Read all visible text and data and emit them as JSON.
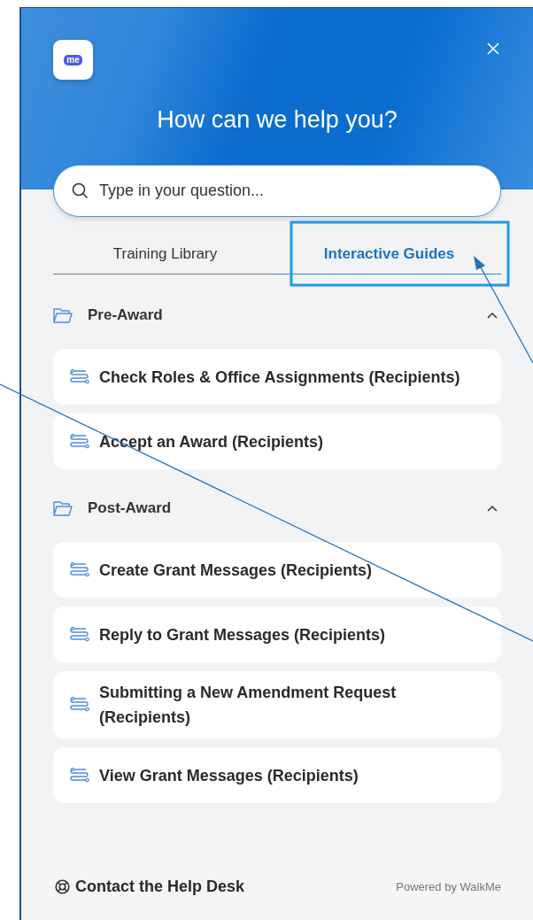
{
  "header": {
    "logo_text": "me",
    "title": "How can we help you?"
  },
  "search": {
    "placeholder": "Type in your question..."
  },
  "tabs": [
    {
      "label": "Training Library",
      "selected": false
    },
    {
      "label": "Interactive Guides",
      "selected": true
    }
  ],
  "sections": [
    {
      "title": "Pre-Award",
      "expanded": true,
      "items": [
        {
          "label": "Check Roles & Office Assignments (Recipients)"
        },
        {
          "label": "Accept an Award (Recipients)"
        }
      ]
    },
    {
      "title": "Post-Award",
      "expanded": true,
      "items": [
        {
          "label": "Create Grant Messages (Recipients)"
        },
        {
          "label": "Reply to Grant Messages (Recipients)"
        },
        {
          "label": "Submitting a New Amendment Request (Recipients)"
        },
        {
          "label": "View Grant Messages (Recipients)"
        }
      ]
    }
  ],
  "footer": {
    "help_link": "Contact the Help Desk",
    "powered_by": "Powered by WalkMe"
  }
}
